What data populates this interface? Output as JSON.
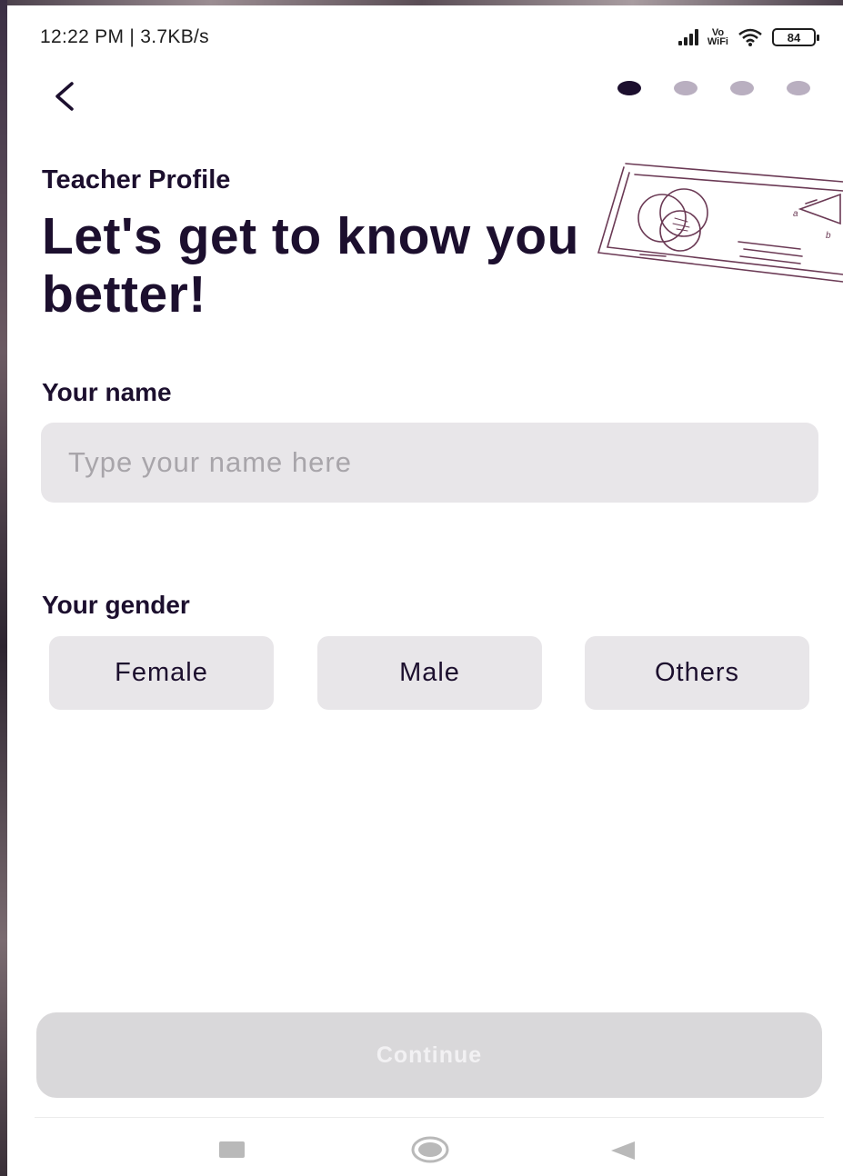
{
  "status_bar": {
    "time_speed": "12:22 PM | 3.7KB/s",
    "network_label": "Vo\nWiFi",
    "battery_level": "84"
  },
  "header": {
    "back_icon": "chevron-left-icon",
    "progress": {
      "total_steps": 4,
      "current_step": 1
    }
  },
  "illustration": {
    "icon": "whiteboard-illustration",
    "color": "#6b3a55"
  },
  "content": {
    "eyebrow": "Teacher Profile",
    "title": "Let's get to know you better!"
  },
  "name_field": {
    "label": "Your name",
    "placeholder": "Type your name here",
    "value": ""
  },
  "gender_field": {
    "label": "Your gender",
    "options": [
      "Female",
      "Male",
      "Others"
    ],
    "selected": null
  },
  "footer": {
    "continue_label": "Continue",
    "continue_enabled": false
  },
  "nav_bar": {
    "recents_icon": "square-icon",
    "home_icon": "circle-icon",
    "back_icon": "triangle-back-icon"
  },
  "colors": {
    "primary_text": "#1c0f2e",
    "input_bg": "#e8e6e9",
    "placeholder": "#a8a5aa",
    "dot_active": "#1c0f2e",
    "dot_inactive": "#b9afc0",
    "button_disabled_bg": "#d9d8da",
    "button_disabled_text": "#f2f1f3"
  }
}
